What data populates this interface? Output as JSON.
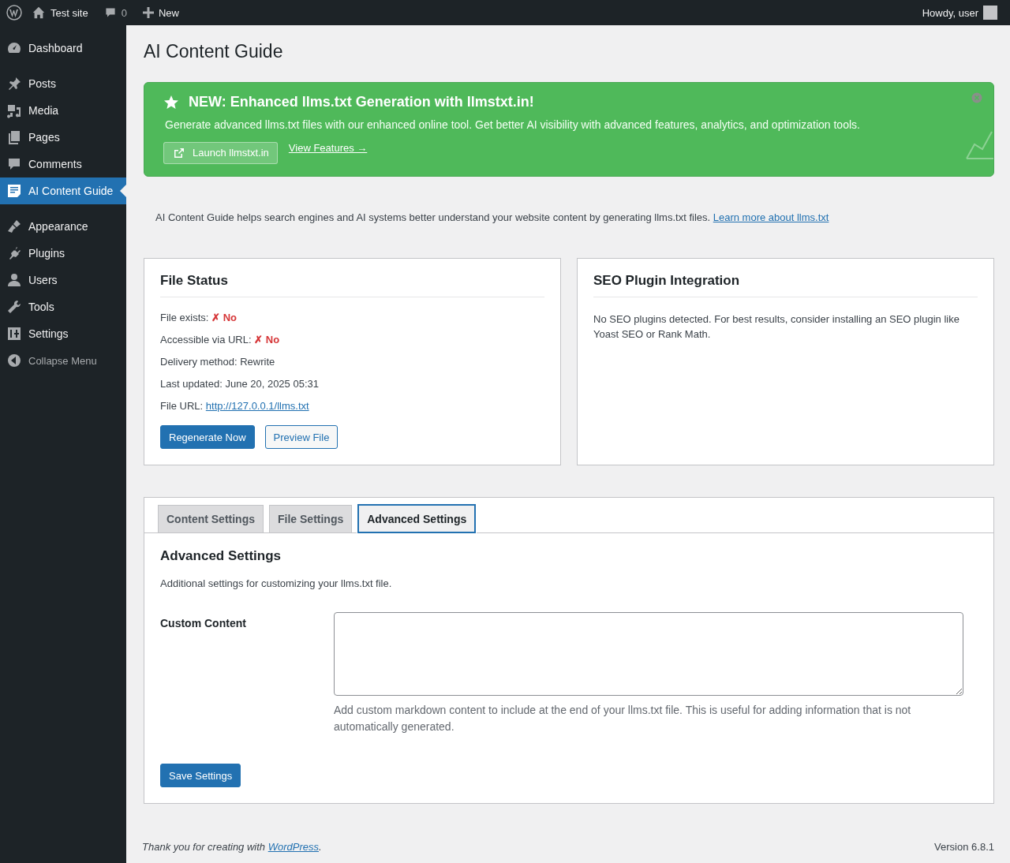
{
  "admin_bar": {
    "site": "Test site",
    "comments": "0",
    "new": "New",
    "greeting": "Howdy, user"
  },
  "sidebar": {
    "items": [
      {
        "kind": "item",
        "label": "Dashboard",
        "selected": false
      },
      {
        "kind": "separator"
      },
      {
        "kind": "item",
        "label": "Posts",
        "selected": false
      },
      {
        "kind": "item",
        "label": "Media",
        "selected": false
      },
      {
        "kind": "item",
        "label": "Pages",
        "selected": false
      },
      {
        "kind": "item",
        "label": "Comments",
        "selected": false
      },
      {
        "kind": "item",
        "label": "AI Content Guide",
        "selected": true
      },
      {
        "kind": "separator"
      },
      {
        "kind": "item",
        "label": "Appearance",
        "selected": false
      },
      {
        "kind": "item",
        "label": "Plugins",
        "selected": false
      },
      {
        "kind": "item",
        "label": "Users",
        "selected": false
      },
      {
        "kind": "item",
        "label": "Tools",
        "selected": false
      },
      {
        "kind": "item",
        "label": "Settings",
        "selected": false
      }
    ],
    "collapse": "Collapse Menu"
  },
  "page": {
    "title": "AI Content Guide"
  },
  "notice": {
    "title": "NEW: Enhanced llms.txt Generation with llmstxt.in!",
    "text": "Generate advanced llms.txt files with our enhanced online tool. Get better AI visibility with advanced features, analytics, and optimization tools.",
    "button": "Launch llmstxt.in",
    "link": "View Features →"
  },
  "intro": {
    "text": "AI Content Guide helps search engines and AI systems better understand your website content by generating llms.txt files.",
    "link": "Learn more about llms.txt"
  },
  "file_status": {
    "title": "File Status",
    "rows": [
      {
        "label": "File exists:",
        "value": "✗ No",
        "kind": "error"
      },
      {
        "label": "Accessible via URL:",
        "value": "✗ No",
        "kind": "error"
      },
      {
        "label": "Delivery method:",
        "value": "Rewrite",
        "kind": "text"
      },
      {
        "label": "Last updated:",
        "value": "June 20, 2025 05:31",
        "kind": "text"
      },
      {
        "label": "File URL:",
        "value": "http://127.0.0.1/llms.txt",
        "kind": "link"
      }
    ],
    "buttons": [
      {
        "label": "Regenerate Now",
        "kind": "primary"
      },
      {
        "label": "Preview File",
        "kind": "secondary"
      }
    ]
  },
  "seo": {
    "title": "SEO Plugin Integration",
    "text": "No SEO plugins detected. For best results, consider installing an SEO plugin like Yoast SEO or Rank Math."
  },
  "tabs": [
    {
      "label": "Content Settings",
      "selected": false
    },
    {
      "label": "File Settings",
      "selected": false
    },
    {
      "label": "Advanced Settings",
      "selected": true
    }
  ],
  "settings": {
    "title": "Advanced Settings",
    "description": "Additional settings for customizing your llms.txt file.",
    "field_label": "Custom Content",
    "help": "Add custom markdown content to include at the end of your llms.txt file. This is useful for adding information that is not automatically generated.",
    "save": "Save Settings"
  },
  "footer": {
    "text": "Thank you for creating with",
    "link": "WordPress",
    "suffix": ".",
    "version": "Version 6.8.1"
  }
}
